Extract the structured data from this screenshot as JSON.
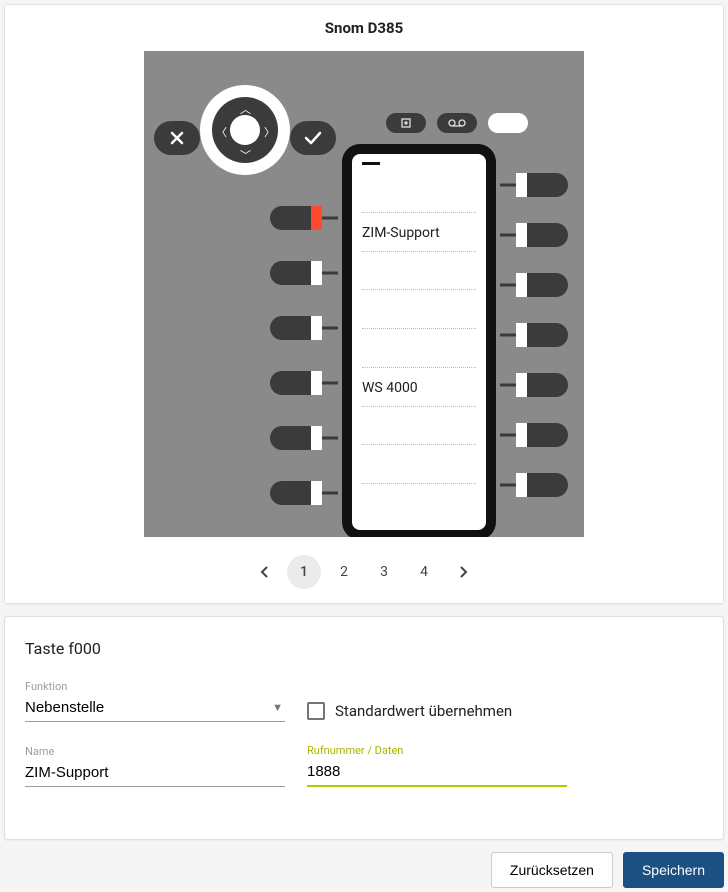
{
  "device_title": "Snom D385",
  "screen_lines": [
    "",
    "ZIM-Support",
    "",
    "",
    "",
    "WS 4000",
    "",
    "",
    ""
  ],
  "side_keys_left_selected_index": 0,
  "paginator": {
    "pages": [
      "1",
      "2",
      "3",
      "4"
    ],
    "active_index": 0
  },
  "form": {
    "title": "Taste f000",
    "fields": {
      "function_label": "Funktion",
      "function_value": "Nebenstelle",
      "default_checkbox_label": "Standardwert übernehmen",
      "default_checked": false,
      "name_label": "Name",
      "name_value": "ZIM-Support",
      "number_label": "Rufnummer / Daten",
      "number_value": "1888"
    }
  },
  "actions": {
    "reset_label": "Zurücksetzen",
    "save_label": "Speichern"
  }
}
